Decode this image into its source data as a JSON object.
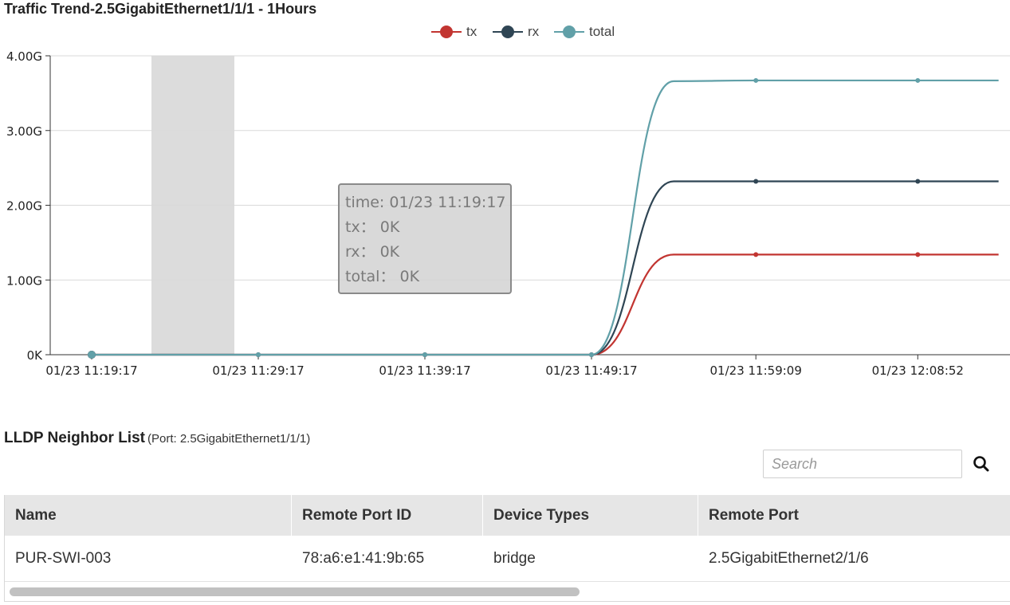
{
  "chart_title": "Traffic Trend-2.5GigabitEthernet1/1/1 - 1Hours",
  "chart_data": {
    "type": "line",
    "title": "Traffic Trend-2.5GigabitEthernet1/1/1 - 1Hours",
    "x_tick_labels": [
      "01/23 11:19:17",
      "01/23 11:29:17",
      "01/23 11:39:17",
      "01/23 11:49:17",
      "01/23 11:59:09",
      "01/23 12:08:52"
    ],
    "y_tick_labels": [
      "0K",
      "1.00G",
      "2.00G",
      "3.00G",
      "4.00G"
    ],
    "ylim_gbps": [
      0,
      4
    ],
    "x": [
      "01/23 11:19:17",
      "01/23 11:29:17",
      "01/23 11:39:17",
      "01/23 11:49:17",
      "01/23 11:54:13",
      "01/23 11:59:09",
      "01/23 12:08:52",
      "01/23 12:13:43"
    ],
    "series": [
      {
        "name": "tx",
        "color": "#c23531",
        "values": [
          0,
          0,
          0,
          0,
          1.34,
          1.34,
          1.34,
          1.34
        ]
      },
      {
        "name": "rx",
        "color": "#2f4554",
        "values": [
          0,
          0,
          0,
          0,
          2.32,
          2.32,
          2.32,
          2.32
        ]
      },
      {
        "name": "total",
        "color": "#61a0a8",
        "values": [
          0,
          0,
          0,
          0,
          3.66,
          3.67,
          3.67,
          3.67
        ]
      }
    ],
    "y_unit": "G",
    "grid": true,
    "legend_position": "top-center",
    "highlighted_x": "01/23 11:19:17"
  },
  "tooltip": {
    "time_line": "time: 01/23 11:19:17",
    "tx_line": "tx： 0K",
    "rx_line": "rx： 0K",
    "total_line": "total： 0K"
  },
  "lldp": {
    "title": "LLDP Neighbor List",
    "port_note": "(Port: 2.5GigabitEthernet1/1/1)",
    "search_placeholder": "Search",
    "search_icon": "search-icon",
    "columns": [
      "Name",
      "Remote Port ID",
      "Device Types",
      "Remote Port"
    ],
    "rows": [
      [
        "PUR-SWI-003",
        "78:a6:e1:41:9b:65",
        "bridge",
        "2.5GigabitEthernet2/1/6"
      ]
    ]
  }
}
